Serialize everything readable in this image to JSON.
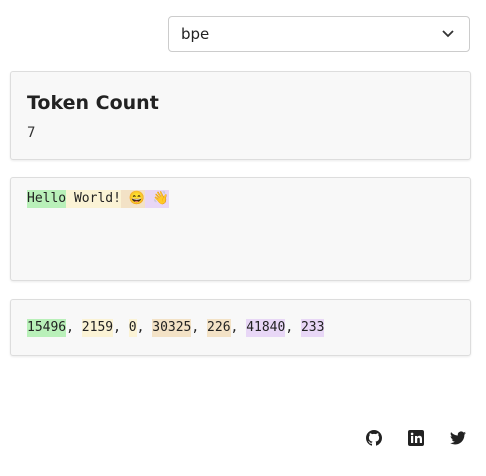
{
  "tokenizer": {
    "selected": "bpe"
  },
  "token_card": {
    "title": "Token Count",
    "count": "7"
  },
  "tokens": [
    {
      "text": "Hello",
      "color": "#b9f0b9"
    },
    {
      "text": " World",
      "color": "#fbf3d5"
    },
    {
      "text": "!",
      "color": "#fbf3d5"
    },
    {
      "text": " ",
      "color": "#f3e2c6"
    },
    {
      "text": "😄",
      "color": "#f3e2c6"
    },
    {
      "text": " ",
      "color": "#e8d7f6"
    },
    {
      "text": "👋",
      "color": "#e8d7f6"
    }
  ],
  "ids": [
    {
      "text": "15496",
      "color": "#b9f0b9"
    },
    {
      "text": "2159",
      "color": "#fbf3d5"
    },
    {
      "text": "0",
      "color": "#fbf3d5"
    },
    {
      "text": "30325",
      "color": "#f3e2c6"
    },
    {
      "text": "226",
      "color": "#f3e2c6"
    },
    {
      "text": "41840",
      "color": "#e8d7f6"
    },
    {
      "text": "233",
      "color": "#e8d7f6"
    }
  ],
  "separator": ", ",
  "footer": {
    "icons": [
      "github-icon",
      "linkedin-icon",
      "twitter-icon"
    ]
  }
}
